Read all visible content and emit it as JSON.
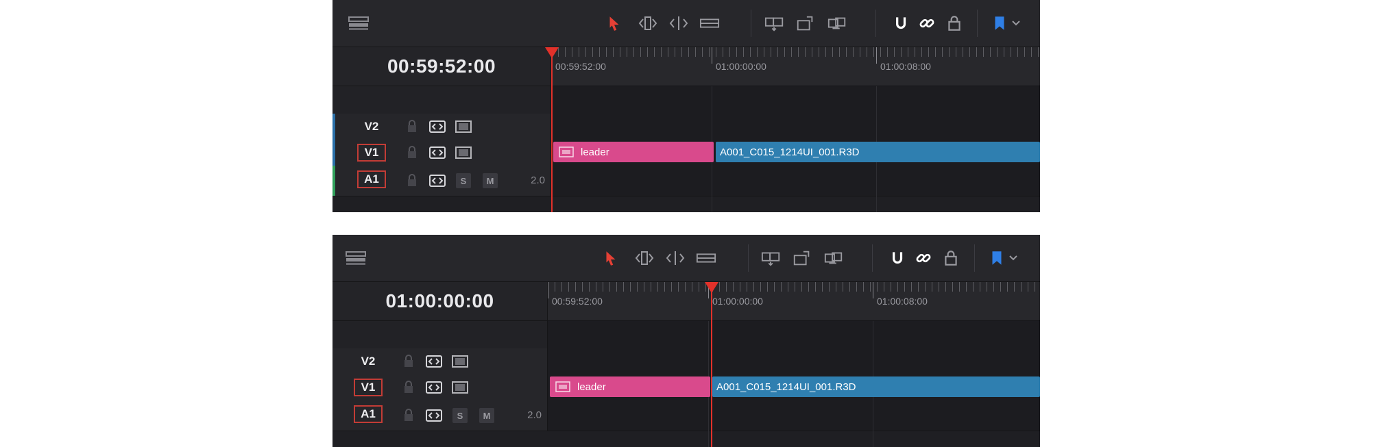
{
  "panels": [
    {
      "timecode": "00:59:52:00",
      "ruler": [
        "00:59:52:00",
        "01:00:00:00",
        "01:00:08:00"
      ],
      "tracks": [
        {
          "name": "V2",
          "type": "video"
        },
        {
          "name": "V1",
          "type": "video"
        },
        {
          "name": "A1",
          "type": "audio",
          "solo": "S",
          "mute": "M",
          "channels": "2.0"
        }
      ],
      "clips": {
        "leader": "leader",
        "main": "A001_C015_1214UI_001.R3D"
      }
    },
    {
      "timecode": "01:00:00:00",
      "ruler": [
        "00:59:52:00",
        "01:00:00:00",
        "01:00:08:00"
      ],
      "tracks": [
        {
          "name": "V2",
          "type": "video"
        },
        {
          "name": "V1",
          "type": "video"
        },
        {
          "name": "A1",
          "type": "audio",
          "solo": "S",
          "mute": "M",
          "channels": "2.0"
        }
      ],
      "clips": {
        "leader": "leader",
        "main": "A001_C015_1214UI_001.R3D"
      }
    }
  ],
  "toolbar_icons": [
    "timeline-view-icon",
    "selection-tool-icon",
    "trim-edit-icon",
    "dynamic-trim-icon",
    "blade-tool-icon",
    "insert-clip-icon",
    "overwrite-clip-icon",
    "replace-clip-icon",
    "snapping-icon",
    "linked-selection-icon",
    "position-lock-icon",
    "flag-icon",
    "dropdown-chevron-icon"
  ],
  "colors": {
    "playhead": "#e2312a",
    "accent_red": "#e64035",
    "leader_clip": "#d94a8c",
    "media_clip": "#2f7fb0",
    "flag": "#2f7fe6",
    "video_track_strip": "#2a6fa8",
    "audio_track_strip": "#2f9f5a"
  }
}
